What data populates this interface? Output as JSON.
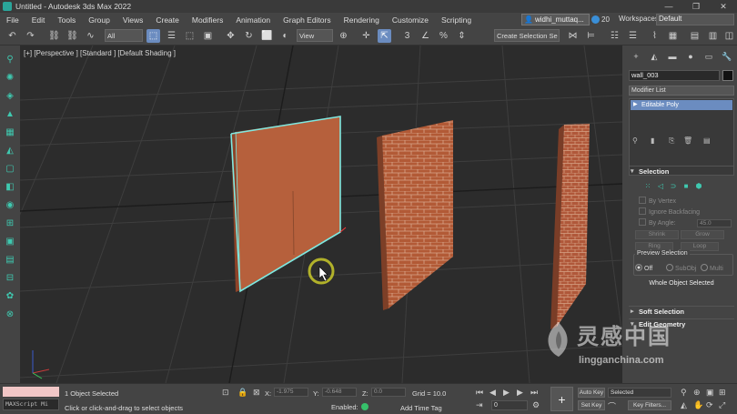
{
  "window": {
    "title": "Untitled - Autodesk 3ds Max 2022",
    "controls": [
      "—",
      "❐",
      "✕"
    ]
  },
  "menu": {
    "items": [
      "File",
      "Edit",
      "Tools",
      "Group",
      "Views",
      "Create",
      "Modifiers",
      "Animation",
      "Graph Editors",
      "Rendering",
      "Customize",
      "Scripting"
    ],
    "user": "widhi_muttaq...",
    "notifications": "20",
    "workspaces_label": "Workspaces:",
    "workspaces_value": "Default"
  },
  "toolbar": {
    "filter_select": "All",
    "view_select": "View",
    "selection_set": "Create Selection Se"
  },
  "viewport": {
    "label": "[+] [Perspective ] [Standard ] [Default Shading ]"
  },
  "command_panel": {
    "object_name": "wall_003",
    "modifier_list": "Modifier List",
    "stack_item": "Editable Poly",
    "selection_title": "Selection",
    "by_vertex": "By Vertex",
    "ignore_backfacing": "Ignore Backfacing",
    "by_angle": "By Angle:",
    "angle_value": "45.0",
    "shrink": "Shrink",
    "grow": "Grow",
    "ring": "Ring",
    "loop": "Loop",
    "preview_selection": "Preview Selection",
    "preview_off": "Off",
    "preview_subobj": "SubObj",
    "preview_multi": "Multi",
    "whole_object_selected": "Whole Object Selected",
    "soft_selection": "Soft Selection",
    "edit_geometry": "Edit Geometry"
  },
  "status": {
    "maxscript": "MAXScript Mi",
    "objects_selected": "1 Object Selected",
    "prompt": "Click or click-and-drag to select objects",
    "x_label": "X:",
    "x_value": "-1.975",
    "y_label": "Y:",
    "y_value": "-0.648",
    "z_label": "Z:",
    "z_value": "0.0",
    "grid": "Grid = 10.0",
    "enabled": "Enabled:",
    "add_time_tag": "Add Time Tag",
    "frame": "0",
    "auto_key": "Auto Key",
    "set_key": "Set Key",
    "selected": "Selected",
    "key_filters": "Key Filters..."
  },
  "watermark": {
    "cn": "灵感中国",
    "en": "lingganchina.com"
  },
  "colors": {
    "accent": "#6b8cc0",
    "tool_teal": "#3fc9b0",
    "selection_outline": "#7fe8e0",
    "brick": "#b25a36",
    "viewport_bg": "#2c2c2c"
  }
}
